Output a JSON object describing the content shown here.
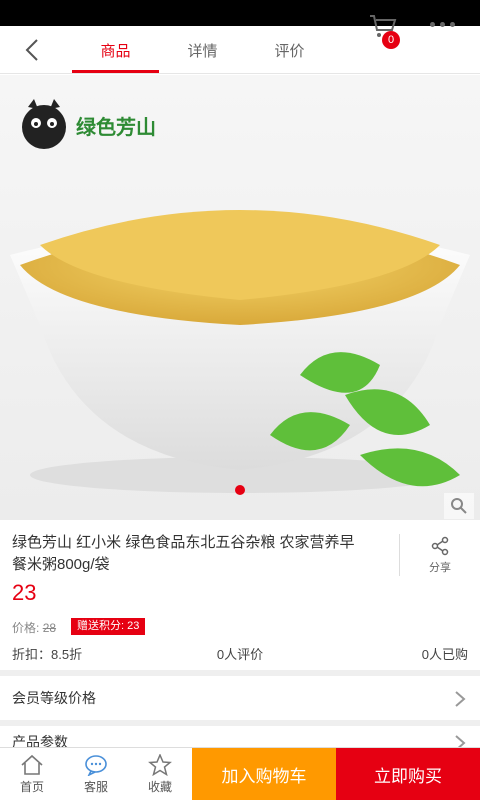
{
  "nav": {
    "tabs": [
      {
        "label": "商品",
        "active": true
      },
      {
        "label": "详情",
        "active": false
      },
      {
        "label": "评价",
        "active": false
      }
    ],
    "cart_count": "0",
    "accent": "#e60012"
  },
  "hero": {
    "brand_text": "绿色芳山",
    "image_count": 1,
    "active_index": 0
  },
  "product": {
    "title": "绿色芳山 红小米 绿色食品东北五谷杂粮 农家营养早餐米粥800g/袋",
    "share_label": "分享",
    "price": "23",
    "original_label": "价格:",
    "original_price": "28",
    "points_badge": "赠送积分: 23",
    "discount": "折扣：8.5折",
    "reviews": "0人评价",
    "bought": "0人已购"
  },
  "sections": {
    "member_price": "会员等级价格",
    "params": "产品参数"
  },
  "bottom_bar": {
    "home": "首页",
    "service": "客服",
    "favorite": "收藏",
    "add_to_cart": "加入购物车",
    "buy_now": "立即购买",
    "cart_color": "#ff9900",
    "buy_color": "#e60012"
  }
}
